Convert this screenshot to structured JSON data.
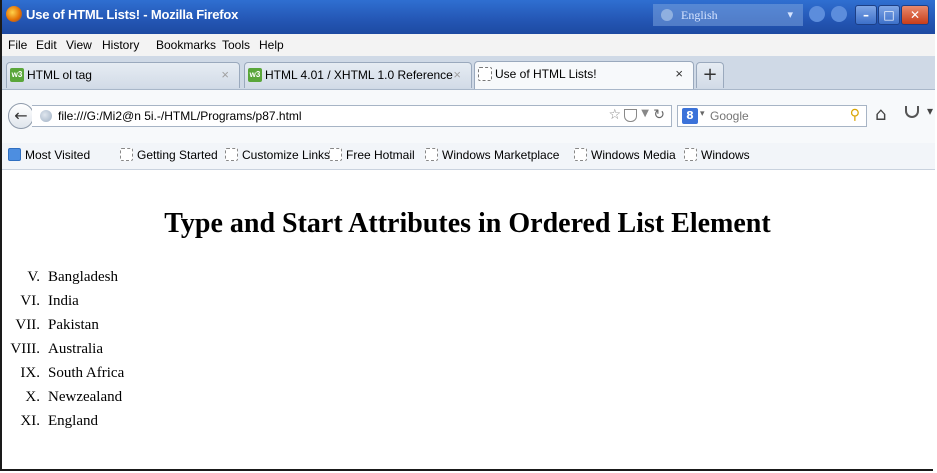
{
  "window": {
    "title": "Use of HTML Lists! - Mozilla Firefox",
    "language_label": "English"
  },
  "menu": {
    "items": [
      "File",
      "Edit",
      "View",
      "History",
      "Bookmarks",
      "Tools",
      "Help"
    ]
  },
  "tabs": [
    {
      "label": "HTML ol tag",
      "icon": "w3schools-favicon",
      "active": false
    },
    {
      "label": "HTML 4.01 / XHTML 1.0 Reference",
      "icon": "w3schools-favicon",
      "active": false
    },
    {
      "label": "Use of HTML Lists!",
      "icon": "blank-page-favicon",
      "active": true
    }
  ],
  "navigation": {
    "url": "file:///G:/Mi2@n 5i.-/HTML/Programs/p87.html",
    "search_engine": "Google",
    "search_placeholder": "Google"
  },
  "bookmarks": {
    "items": [
      "Most Visited",
      "Getting Started",
      "Customize Links",
      "Free Hotmail",
      "Windows Marketplace",
      "Windows Media",
      "Windows"
    ]
  },
  "page": {
    "heading": "Type and Start Attributes in Ordered List Element",
    "list": [
      {
        "marker": "V.",
        "text": "Bangladesh"
      },
      {
        "marker": "VI.",
        "text": "India"
      },
      {
        "marker": "VII.",
        "text": "Pakistan"
      },
      {
        "marker": "VIII.",
        "text": "Australia"
      },
      {
        "marker": "IX.",
        "text": "South Africa"
      },
      {
        "marker": "X.",
        "text": "Newzealand"
      },
      {
        "marker": "XI.",
        "text": "England"
      }
    ]
  }
}
